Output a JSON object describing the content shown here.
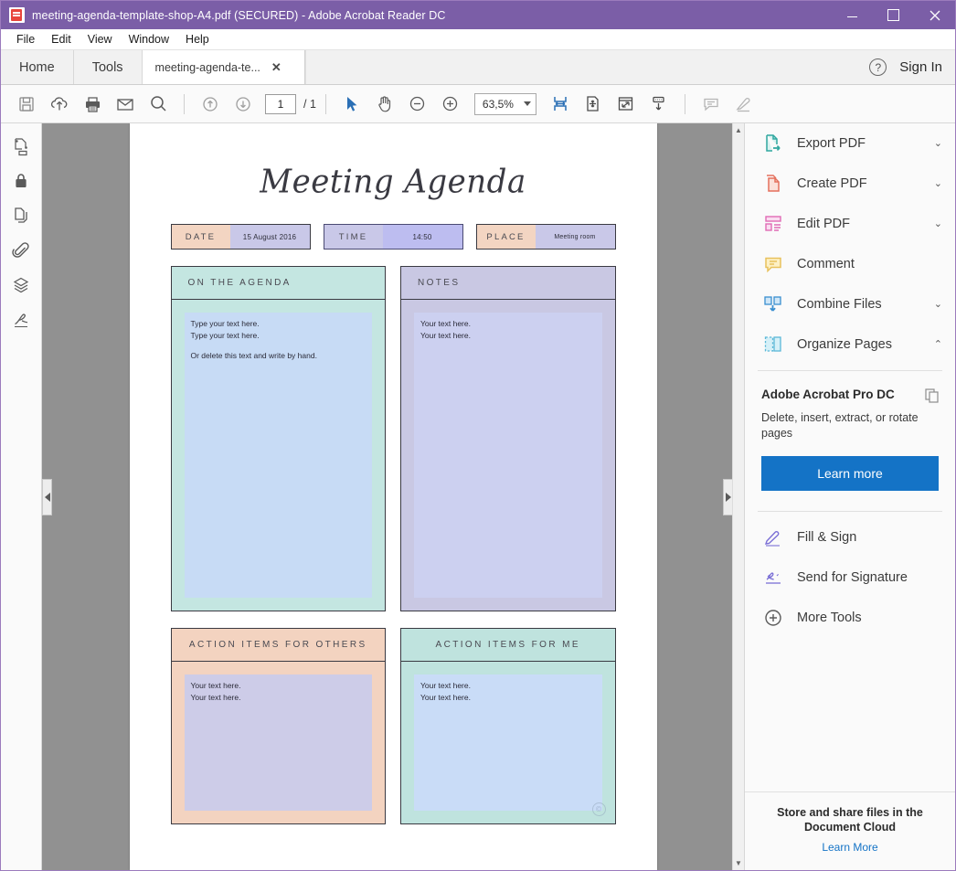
{
  "window": {
    "title": "meeting-agenda-template-shop-A4.pdf (SECURED) - Adobe Acrobat Reader DC",
    "minimize_label": "–",
    "maximize_label": "□",
    "close_label": "✕"
  },
  "menu": [
    "File",
    "Edit",
    "View",
    "Window",
    "Help"
  ],
  "tabs": {
    "home": "Home",
    "tools": "Tools",
    "document": "meeting-agenda-te...",
    "close": "✕",
    "help_icon": "?",
    "sign_in": "Sign In"
  },
  "toolbar": {
    "icons": [
      "save-icon",
      "upload-cloud-icon",
      "print-icon",
      "email-icon",
      "search-icon",
      "previous-page-icon",
      "next-page-icon"
    ],
    "page_number": "1",
    "page_total": "/ 1",
    "select_tool": "select-cursor-icon",
    "hand_tool": "hand-icon",
    "zoom_out": "zoom-out-icon",
    "zoom_in": "zoom-in-icon",
    "zoom_value": "63,5%",
    "fit_width_icon": "fit-width-icon",
    "fit_page_icon": "fit-page-icon",
    "full_screen_icon": "full-screen-icon",
    "scroll_mode_icon": "scroll-mode-icon",
    "comment_icon": "comment-icon",
    "highlight_icon": "highlight-icon"
  },
  "left_rail": [
    "page-thumbnails-icon",
    "security-lock-icon",
    "pages-icon",
    "attachments-paperclip-icon",
    "layers-icon",
    "signature-icon"
  ],
  "navigation": {
    "collapse_left": "◀",
    "collapse_right": "▶",
    "scroll_up": "▲",
    "scroll_down": "▼"
  },
  "right_panel": {
    "tools": [
      {
        "label": "Export PDF",
        "icon": "export-pdf-icon",
        "chevron": "⌄",
        "expanded": false
      },
      {
        "label": "Create PDF",
        "icon": "create-pdf-icon",
        "chevron": "⌄",
        "expanded": false
      },
      {
        "label": "Edit PDF",
        "icon": "edit-pdf-icon",
        "chevron": "⌄",
        "expanded": false
      },
      {
        "label": "Comment",
        "icon": "comment-bubble-icon",
        "chevron": "",
        "expanded": false
      },
      {
        "label": "Combine Files",
        "icon": "combine-files-icon",
        "chevron": "⌄",
        "expanded": false
      },
      {
        "label": "Organize Pages",
        "icon": "organize-pages-icon",
        "chevron": "⌃",
        "expanded": true
      }
    ],
    "promo": {
      "title": "Adobe Acrobat Pro DC",
      "copy_icon": "copy-pages-icon",
      "description": "Delete, insert, extract, or rotate pages",
      "button": "Learn more"
    },
    "more_tools": [
      {
        "label": "Fill & Sign",
        "icon": "fill-and-sign-icon"
      },
      {
        "label": "Send for Signature",
        "icon": "send-for-signature-icon"
      },
      {
        "label": "More Tools",
        "icon": "plus-circle-icon"
      }
    ],
    "footer": {
      "line1": "Store and share files in the",
      "line2": "Document Cloud",
      "link": "Learn More"
    }
  },
  "document": {
    "title": "Meeting Agenda",
    "header_fields": [
      {
        "label": "DATE",
        "value": "15 August 2016"
      },
      {
        "label": "TIME",
        "value": "14:50"
      },
      {
        "label": "PLACE",
        "value": "Meeting room"
      }
    ],
    "boxes": {
      "agenda": {
        "title": "ON THE AGENDA",
        "line1": "Type your text here.",
        "line2": "Type your text here.",
        "line3": "Or delete this text and write by hand."
      },
      "notes": {
        "title": "NOTES",
        "line1": "Your text here.",
        "line2": "Your text here."
      },
      "action_others": {
        "title": "ACTION ITEMS FOR OTHERS",
        "line1": "Your text here.",
        "line2": "Your text here."
      },
      "action_me": {
        "title": "ACTION ITEMS FOR ME",
        "line1": "Your text here.",
        "line2": "Your text here.",
        "watermark": "©"
      }
    }
  },
  "colors": {
    "titlebar": "#7b5ea7",
    "accent_button": "#1473c6",
    "link": "#1473c6",
    "agenda_box": "#c4e6e1",
    "notes_box": "#c9c8e3",
    "action_others_box": "#f3d3c0",
    "action_me_box": "#bfe3de"
  }
}
